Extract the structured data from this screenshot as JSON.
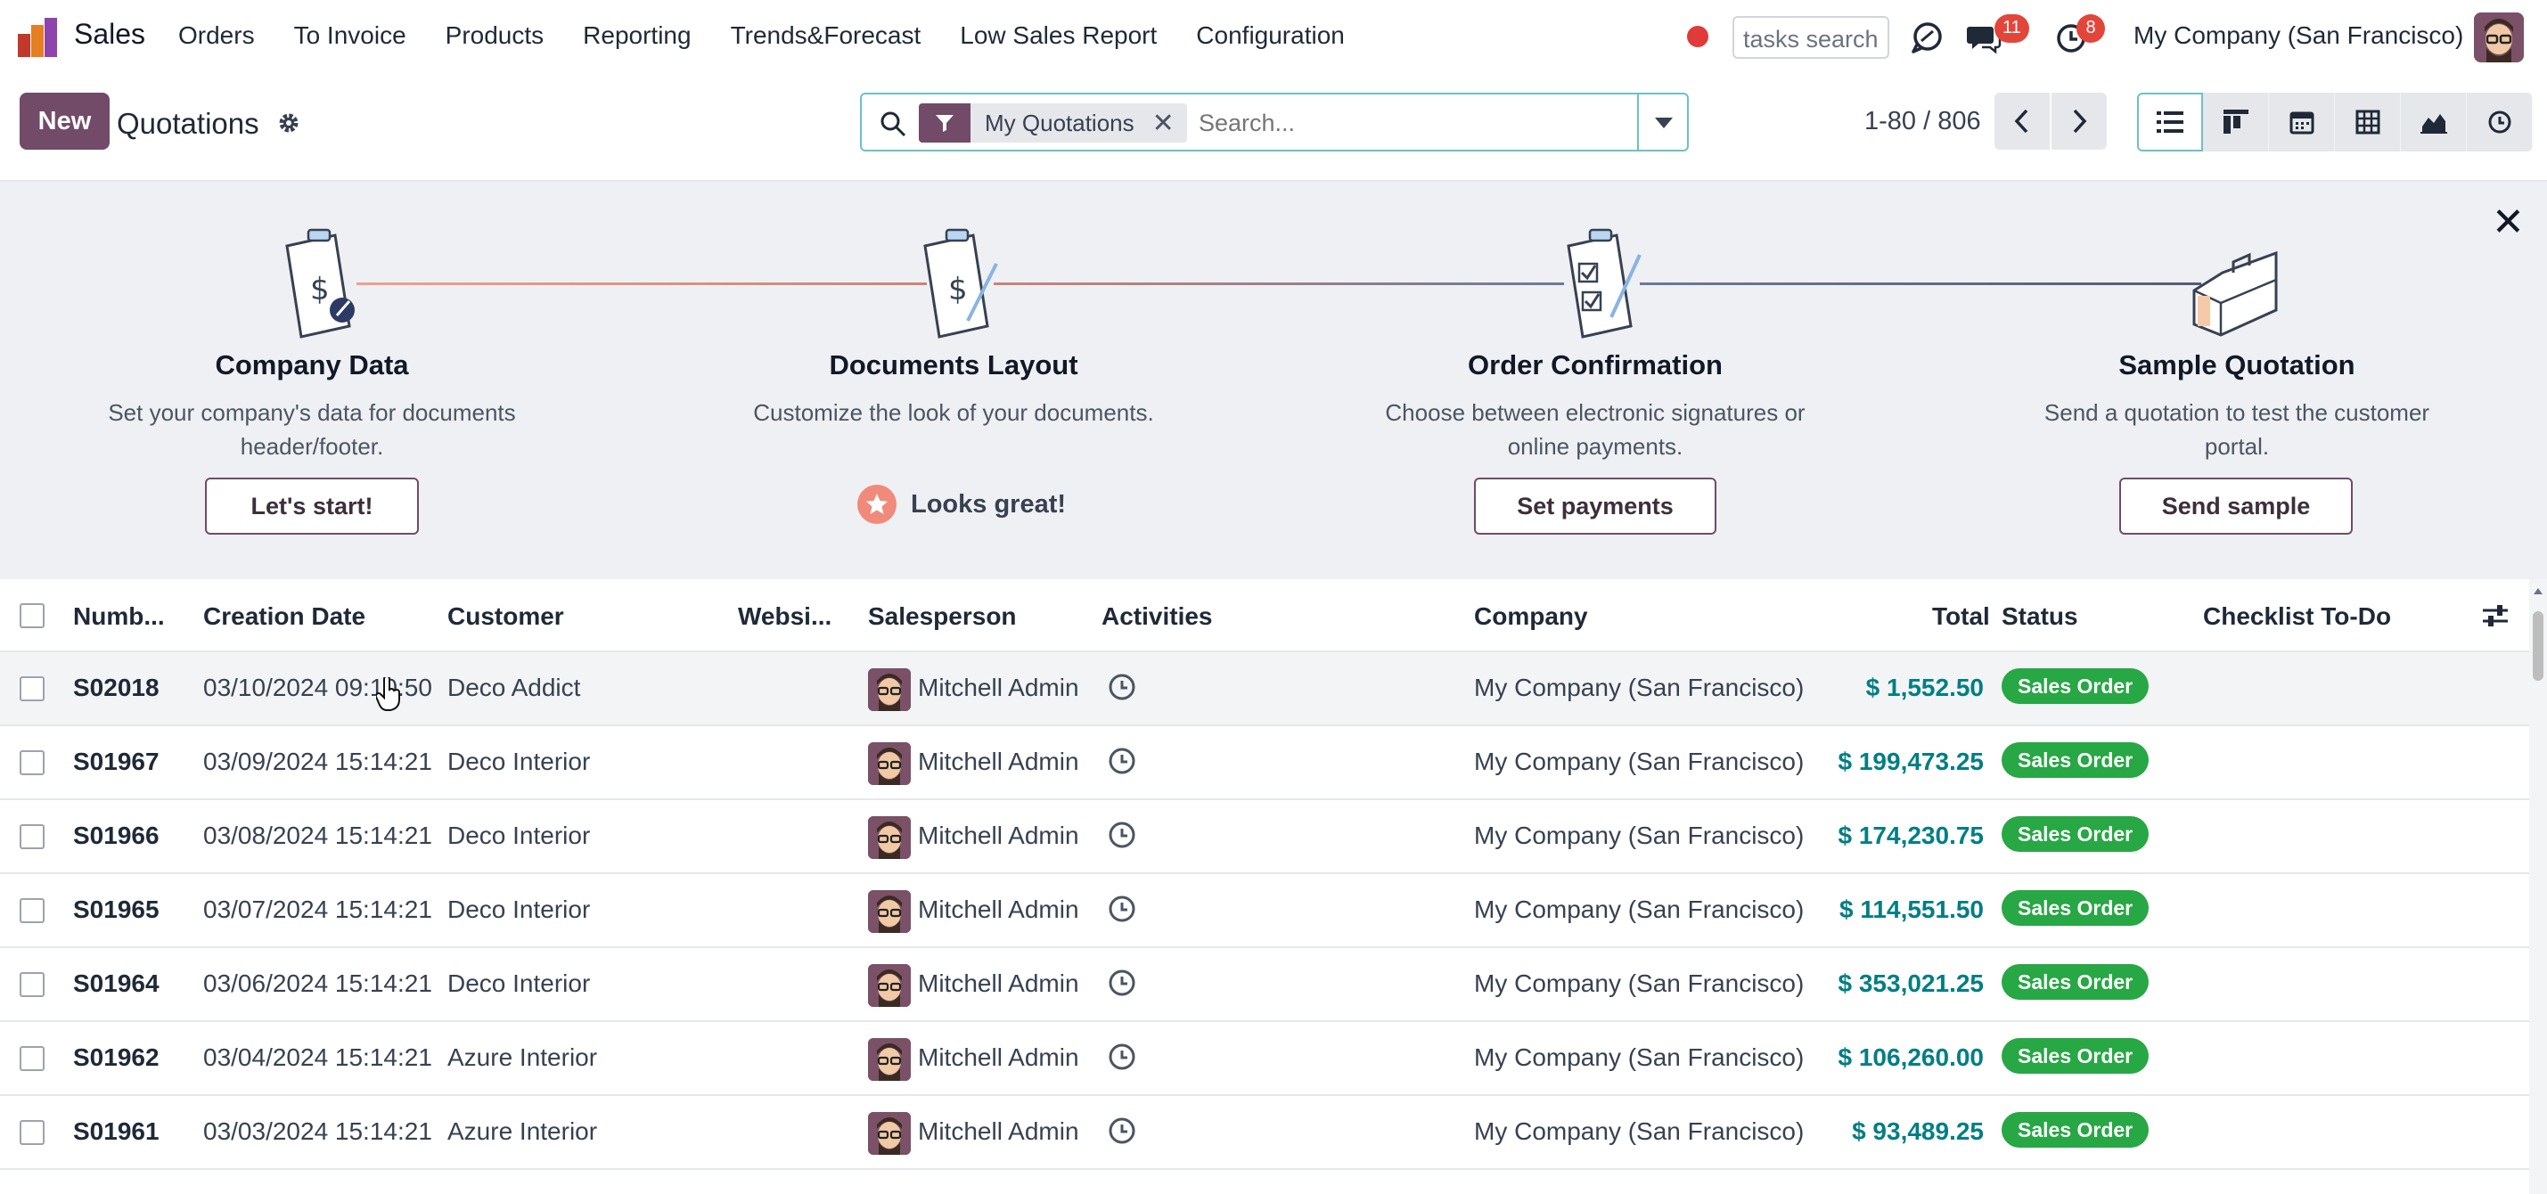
{
  "navbar": {
    "app_name": "Sales",
    "menu": [
      "Orders",
      "To Invoice",
      "Products",
      "Reporting",
      "Trends&Forecast",
      "Low Sales Report",
      "Configuration"
    ],
    "task_search_placeholder": "tasks search",
    "messages_badge": "11",
    "activities_badge": "8",
    "company": "My Company (San Francisco)"
  },
  "control_panel": {
    "new_label": "New",
    "title": "Quotations",
    "facet_label": "My Quotations",
    "search_placeholder": "Search...",
    "pager_value": "1-80 / 806"
  },
  "onboarding": {
    "steps": [
      {
        "title": "Company Data",
        "desc_line1": "Set your company's data for documents",
        "desc_line2": "header/footer.",
        "button": "Let's start!"
      },
      {
        "title": "Documents Layout",
        "desc_line1": "Customize the look of your documents.",
        "desc_line2": "",
        "done_label": "Looks great!"
      },
      {
        "title": "Order Confirmation",
        "desc_line1": "Choose between electronic signatures or",
        "desc_line2": "online payments.",
        "button": "Set payments"
      },
      {
        "title": "Sample Quotation",
        "desc_line1": "Send a quotation to test the customer",
        "desc_line2": "portal.",
        "button": "Send sample"
      }
    ]
  },
  "table": {
    "columns": {
      "number": "Numb...",
      "creation_date": "Creation Date",
      "customer": "Customer",
      "website": "Websi...",
      "salesperson": "Salesperson",
      "activities": "Activities",
      "company": "Company",
      "total": "Total",
      "status": "Status",
      "checklist": "Checklist To-Do"
    },
    "rows": [
      {
        "number": "S02018",
        "date": "03/10/2024 09:10:50",
        "customer": "Deco Addict",
        "salesperson": "Mitchell Admin",
        "company": "My Company (San Francisco)",
        "total": "$ 1,552.50",
        "status": "Sales Order"
      },
      {
        "number": "S01967",
        "date": "03/09/2024 15:14:21",
        "customer": "Deco Interior",
        "salesperson": "Mitchell Admin",
        "company": "My Company (San Francisco)",
        "total": "$ 199,473.25",
        "status": "Sales Order"
      },
      {
        "number": "S01966",
        "date": "03/08/2024 15:14:21",
        "customer": "Deco Interior",
        "salesperson": "Mitchell Admin",
        "company": "My Company (San Francisco)",
        "total": "$ 174,230.75",
        "status": "Sales Order"
      },
      {
        "number": "S01965",
        "date": "03/07/2024 15:14:21",
        "customer": "Deco Interior",
        "salesperson": "Mitchell Admin",
        "company": "My Company (San Francisco)",
        "total": "$ 114,551.50",
        "status": "Sales Order"
      },
      {
        "number": "S01964",
        "date": "03/06/2024 15:14:21",
        "customer": "Deco Interior",
        "salesperson": "Mitchell Admin",
        "company": "My Company (San Francisco)",
        "total": "$ 353,021.25",
        "status": "Sales Order"
      },
      {
        "number": "S01962",
        "date": "03/04/2024 15:14:21",
        "customer": "Azure Interior",
        "salesperson": "Mitchell Admin",
        "company": "My Company (San Francisco)",
        "total": "$ 106,260.00",
        "status": "Sales Order"
      },
      {
        "number": "S01961",
        "date": "03/03/2024 15:14:21",
        "customer": "Azure Interior",
        "salesperson": "Mitchell Admin",
        "company": "My Company (San Francisco)",
        "total": "$ 93,489.25",
        "status": "Sales Order"
      }
    ]
  },
  "colors": {
    "brand": "#714b67",
    "accent": "#017e84",
    "status_green": "#28a745",
    "badge_red": "#e2463b"
  }
}
